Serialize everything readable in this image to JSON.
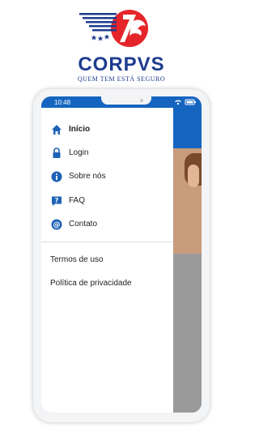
{
  "brand": {
    "name": "CORPVS",
    "tagline": "QUEM TEM ESTÁ SEGURO"
  },
  "status_bar": {
    "time": "10:48"
  },
  "drawer": {
    "menu": [
      {
        "label": "Início",
        "icon": "home-icon",
        "active": true
      },
      {
        "label": "Login",
        "icon": "lock-icon",
        "active": false
      },
      {
        "label": "Sobre nós",
        "icon": "info-icon",
        "active": false
      },
      {
        "label": "FAQ",
        "icon": "faq-icon",
        "active": false
      },
      {
        "label": "Contato",
        "icon": "at-icon",
        "active": false
      }
    ],
    "links": [
      {
        "label": "Termos de uso"
      },
      {
        "label": "Política de privacidade"
      }
    ]
  },
  "colors": {
    "brand_blue": "#1d3c8f",
    "brand_red": "#e5252a",
    "app_blue": "#1565c0",
    "icon_blue": "#1e63b5"
  }
}
